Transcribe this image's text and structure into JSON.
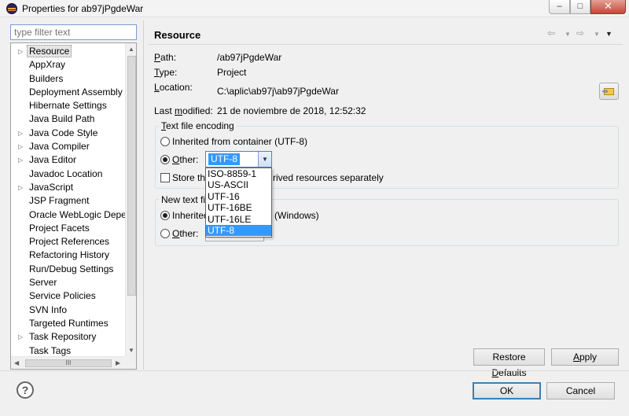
{
  "window": {
    "title": "Properties for ab97jPgdeWar",
    "min_glyph": "–",
    "max_glyph": "□",
    "close_glyph": "✕"
  },
  "filter": {
    "placeholder": "type filter text"
  },
  "tree": {
    "items": [
      {
        "label": "Resource",
        "expandable": true,
        "selected": true
      },
      {
        "label": "AppXray",
        "expandable": false
      },
      {
        "label": "Builders",
        "expandable": false
      },
      {
        "label": "Deployment Assembly",
        "expandable": false
      },
      {
        "label": "Hibernate Settings",
        "expandable": false
      },
      {
        "label": "Java Build Path",
        "expandable": false
      },
      {
        "label": "Java Code Style",
        "expandable": true
      },
      {
        "label": "Java Compiler",
        "expandable": true
      },
      {
        "label": "Java Editor",
        "expandable": true
      },
      {
        "label": "Javadoc Location",
        "expandable": false
      },
      {
        "label": "JavaScript",
        "expandable": true
      },
      {
        "label": "JSP Fragment",
        "expandable": false
      },
      {
        "label": "Oracle WebLogic Deper",
        "expandable": false
      },
      {
        "label": "Project Facets",
        "expandable": false
      },
      {
        "label": "Project References",
        "expandable": false
      },
      {
        "label": "Refactoring History",
        "expandable": false
      },
      {
        "label": "Run/Debug Settings",
        "expandable": false
      },
      {
        "label": "Server",
        "expandable": false
      },
      {
        "label": "Service Policies",
        "expandable": false
      },
      {
        "label": "SVN Info",
        "expandable": false
      },
      {
        "label": "Targeted Runtimes",
        "expandable": false
      },
      {
        "label": "Task Repository",
        "expandable": true
      },
      {
        "label": "Task Tags",
        "expandable": false
      }
    ],
    "hscroll_grip": "III"
  },
  "page": {
    "title": "Resource",
    "path_label_u": "P",
    "path_label_rest": "ath:",
    "path_value": "/ab97jPgdeWar",
    "type_label_u": "T",
    "type_label_rest": "ype:",
    "type_value": "Project",
    "location_label_u": "L",
    "location_label_rest": "ocation:",
    "location_value": "C:\\aplic\\ab97j\\ab97jPgdeWar",
    "modified_label_pre": "Last ",
    "modified_label_u": "m",
    "modified_label_post": "odified:",
    "modified_value": "21 de noviembre de 2018, 12:52:32"
  },
  "encoding": {
    "group_title_u": "T",
    "group_title_rest": "ext file encoding",
    "inherited_label": "Inherited from container (UTF-8)",
    "other_label_u": "O",
    "other_label_rest": "ther:",
    "selected_value": "UTF-8",
    "options": [
      "ISO-8859-1",
      "US-ASCII",
      "UTF-16",
      "UTF-16BE",
      "UTF-16LE",
      "UTF-8"
    ],
    "store_label_left": "Store th",
    "store_label_right": "rived resources separately"
  },
  "delimiter": {
    "group_title": "New text fil",
    "inherited_label_left": "Inherited",
    "inherited_label_right": "(Windows)",
    "other_label_u": "O",
    "other_label_rest": "ther:"
  },
  "buttons": {
    "restore_pre": "Restore ",
    "restore_u": "D",
    "restore_post": "efaults",
    "apply_u": "A",
    "apply_rest": "pply",
    "ok": "OK",
    "cancel": "Cancel"
  }
}
